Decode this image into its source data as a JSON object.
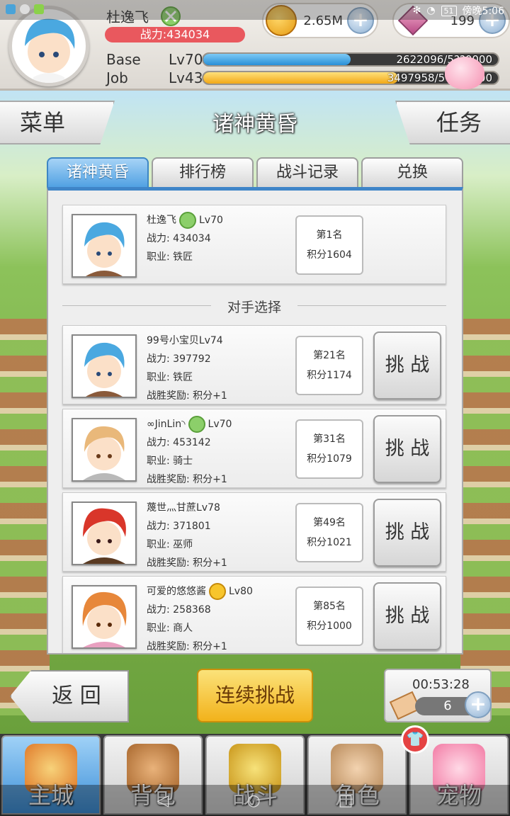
{
  "status_bar": {
    "time": "傍晚5:06",
    "battery": "51"
  },
  "player": {
    "name": "杜逸飞",
    "power": "战力:434034",
    "base_label": "Base",
    "base_level": "Lv70",
    "base_exp": "2622096/5??0000",
    "base_fraction": 0.5,
    "job_label": "Job",
    "job_level": "Lv43",
    "job_exp": "3497958/5??????00",
    "job_fraction": 0.66
  },
  "currency": {
    "gold": "2.65M",
    "gems": "199"
  },
  "header": {
    "menu": "菜单",
    "title": "诸神黄昏",
    "quest": "任务"
  },
  "tabs": [
    "诸神黄昏",
    "排行榜",
    "战斗记录",
    "兑换"
  ],
  "self_card": {
    "name": "杜逸飞",
    "level": "Lv70",
    "power": "战力: 434034",
    "job": "职业: 铁匠",
    "rank": "第1名",
    "points": "积分1604"
  },
  "opponents_label": "对手选择",
  "opponents": [
    {
      "name": "99号小宝贝Lv74",
      "power": "战力: 397792",
      "job": "职业: 铁匠",
      "reward": "战胜奖励: 积分+1",
      "rank": "第21名",
      "points": "积分1174",
      "button": "挑 战",
      "hair": "#4aa8e0"
    },
    {
      "name": "∞JinLin◝",
      "level": "Lv70",
      "power": "战力: 453142",
      "job": "职业: 骑士",
      "reward": "战胜奖励: 积分+1",
      "rank": "第31名",
      "points": "积分1079",
      "button": "挑 战",
      "hair": "#e9b87a"
    },
    {
      "name": "蔑世灬甘蔗Lv78",
      "power": "战力: 371801",
      "job": "职业: 巫师",
      "reward": "战胜奖励: 积分+1",
      "rank": "第49名",
      "points": "积分1021",
      "button": "挑 战",
      "hair": "#d9362a"
    },
    {
      "name": "可爱的悠悠酱",
      "level": "Lv80",
      "power": "战力: 258368",
      "job": "职业: 商人",
      "reward": "战胜奖励: 积分+1",
      "rank": "第85名",
      "points": "积分1000",
      "button": "挑 战",
      "hair": "#e7873a"
    }
  ],
  "bottom": {
    "back": "返 回",
    "continuous": "连续挑战",
    "timer": "00:53:28",
    "tickets": "6"
  },
  "nav": [
    "主城",
    "背包",
    "战斗",
    "角色",
    "宠物"
  ],
  "colors": {
    "accent": "#3f85c8",
    "gold_button": "#f2b21b",
    "power_pill": "#e9585e"
  }
}
